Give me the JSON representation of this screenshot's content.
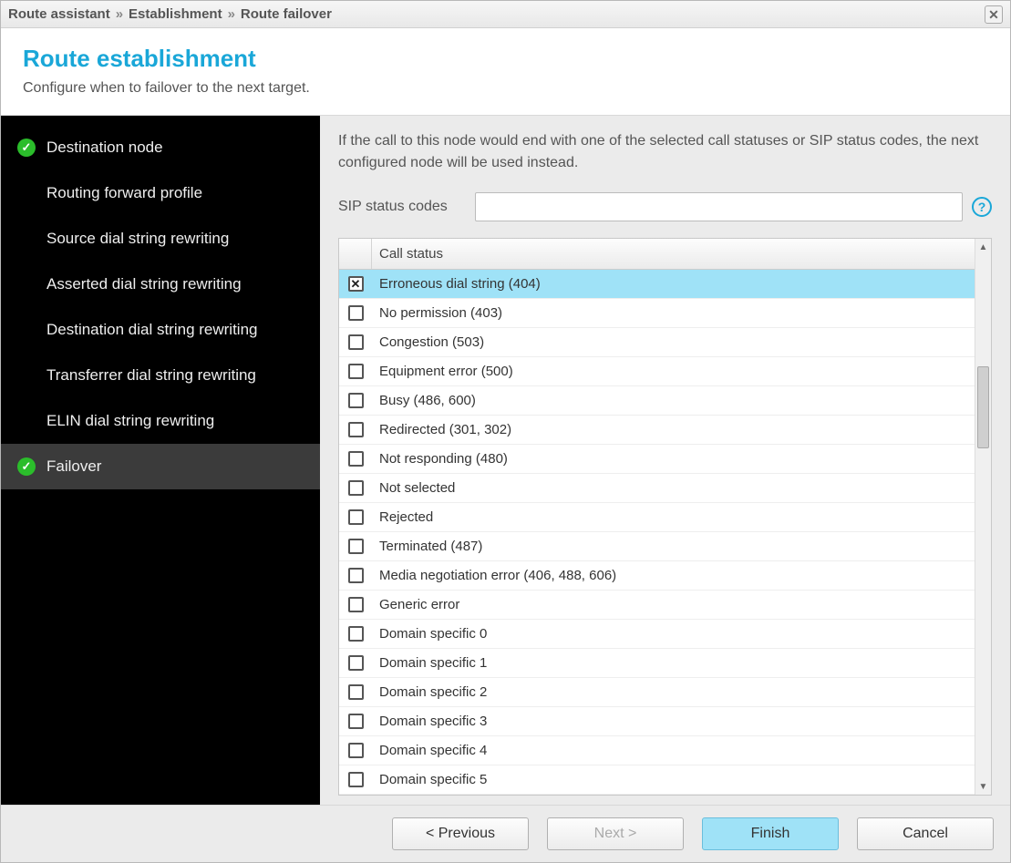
{
  "titlebar": {
    "crumbs": [
      "Route assistant",
      "Establishment",
      "Route failover"
    ]
  },
  "header": {
    "title": "Route establishment",
    "subtitle": "Configure when to failover to the next target."
  },
  "sidebar": {
    "items": [
      {
        "label": "Destination node",
        "checked": true,
        "active": false
      },
      {
        "label": "Routing forward profile",
        "checked": false,
        "active": false
      },
      {
        "label": "Source dial string rewriting",
        "checked": false,
        "active": false
      },
      {
        "label": "Asserted dial string rewriting",
        "checked": false,
        "active": false
      },
      {
        "label": "Destination dial string rewriting",
        "checked": false,
        "active": false
      },
      {
        "label": "Transferrer dial string rewriting",
        "checked": false,
        "active": false
      },
      {
        "label": "ELIN dial string rewriting",
        "checked": false,
        "active": false
      },
      {
        "label": "Failover",
        "checked": true,
        "active": true
      }
    ]
  },
  "main": {
    "intro": "If the call to this node would end with one of the selected call statuses or SIP status codes, the next configured node will be used instead.",
    "sip_label": "SIP status codes",
    "sip_value": "",
    "grid": {
      "header": "Call status",
      "rows": [
        {
          "label": "Erroneous dial string (404)",
          "checked": true,
          "selected": true
        },
        {
          "label": "No permission (403)",
          "checked": false,
          "selected": false
        },
        {
          "label": "Congestion (503)",
          "checked": false,
          "selected": false
        },
        {
          "label": "Equipment error (500)",
          "checked": false,
          "selected": false
        },
        {
          "label": "Busy (486, 600)",
          "checked": false,
          "selected": false
        },
        {
          "label": "Redirected (301, 302)",
          "checked": false,
          "selected": false
        },
        {
          "label": "Not responding (480)",
          "checked": false,
          "selected": false
        },
        {
          "label": "Not selected",
          "checked": false,
          "selected": false
        },
        {
          "label": "Rejected",
          "checked": false,
          "selected": false
        },
        {
          "label": "Terminated (487)",
          "checked": false,
          "selected": false
        },
        {
          "label": "Media negotiation error (406, 488, 606)",
          "checked": false,
          "selected": false
        },
        {
          "label": "Generic error",
          "checked": false,
          "selected": false
        },
        {
          "label": "Domain specific 0",
          "checked": false,
          "selected": false
        },
        {
          "label": "Domain specific 1",
          "checked": false,
          "selected": false
        },
        {
          "label": "Domain specific 2",
          "checked": false,
          "selected": false
        },
        {
          "label": "Domain specific 3",
          "checked": false,
          "selected": false
        },
        {
          "label": "Domain specific 4",
          "checked": false,
          "selected": false
        },
        {
          "label": "Domain specific 5",
          "checked": false,
          "selected": false
        }
      ]
    }
  },
  "footer": {
    "previous": "< Previous",
    "next": "Next >",
    "finish": "Finish",
    "cancel": "Cancel"
  }
}
